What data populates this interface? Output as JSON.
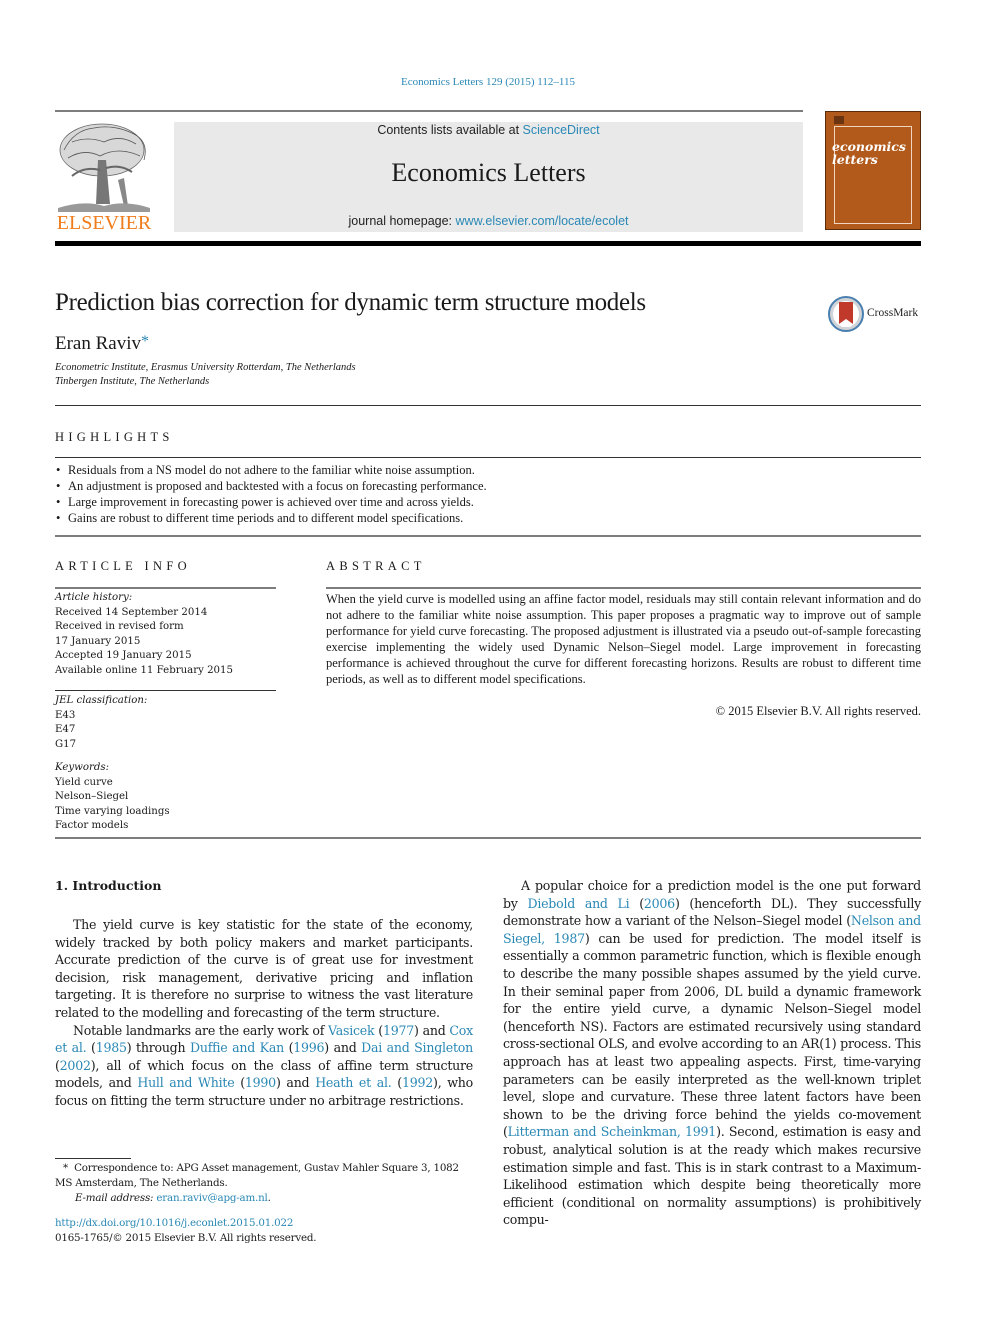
{
  "running_head": "Economics Letters 129 (2015) 112–115",
  "publisher": {
    "logo_word": "ELSEVIER",
    "colors": {
      "orange": "#f07c1b",
      "link_blue": "#2a88b5",
      "cover_brown": "#b15a1b",
      "banner_gray": "#e9e9e9"
    }
  },
  "banner": {
    "contents_prefix": "Contents lists available at ",
    "contents_link": "ScienceDirect",
    "journal_title": "Economics Letters",
    "homepage_prefix": "journal homepage: ",
    "homepage_link": "www.elsevier.com/locate/ecolet"
  },
  "cover": {
    "title_line1": "economics",
    "title_line2": "letters"
  },
  "article": {
    "title": "Prediction bias correction for dynamic term structure models",
    "author": "Eran Raviv",
    "author_mark": "*",
    "affiliations": [
      "Econometric Institute, Erasmus University Rotterdam, The Netherlands",
      "Tinbergen Institute, The Netherlands"
    ],
    "crossmark_label": "CrossMark"
  },
  "highlights": {
    "heading": "HIGHLIGHTS",
    "items": [
      "Residuals from a NS model do not adhere to the familiar white noise assumption.",
      "An adjustment is proposed and backtested with a focus on forecasting performance.",
      "Large improvement in forecasting power is achieved over time and across yields.",
      "Gains are robust to different time periods and to different model specifications."
    ]
  },
  "article_info": {
    "heading": "ARTICLE INFO",
    "history_label": "Article history:",
    "history": [
      "Received 14 September 2014",
      "Received in revised form",
      "17 January 2015",
      "Accepted 19 January 2015",
      "Available online 11 February 2015"
    ],
    "jel_label": "JEL classification:",
    "jel": [
      "E43",
      "E47",
      "G17"
    ],
    "keywords_label": "Keywords:",
    "keywords": [
      "Yield curve",
      "Nelson–Siegel",
      "Time varying loadings",
      "Factor models"
    ]
  },
  "abstract": {
    "heading": "ABSTRACT",
    "text": "When the yield curve is modelled using an affine factor model, residuals may still contain relevant information and do not adhere to the familiar white noise assumption. This paper proposes a pragmatic way to improve out of sample performance for yield curve forecasting. The proposed adjustment is illustrated via a pseudo out-of-sample forecasting exercise implementing the widely used Dynamic Nelson–Siegel model. Large improvement in forecasting performance is achieved throughout the curve for different forecasting horizons. Results are robust to different time periods, as well as to different model specifications.",
    "copyright": "© 2015 Elsevier B.V. All rights reserved."
  },
  "introduction": {
    "heading": "1.  Introduction",
    "p1": "The yield curve is key statistic for the state of the economy, widely tracked by both policy makers and market participants. Accurate prediction of the curve is of great use for investment decision, risk management, derivative pricing and inflation targeting. It is therefore no surprise to witness the vast literature related to the modelling and forecasting of the term structure.",
    "p2": {
      "t0": "Notable landmarks are the early work of ",
      "l0": "Vasicek",
      "t1": " (",
      "l1": "1977",
      "t2": ") and ",
      "l2": "Cox et al.",
      "t3": " (",
      "l3": "1985",
      "t4": ") through ",
      "l4": "Duffie and Kan",
      "t5": " (",
      "l5": "1996",
      "t6": ") and ",
      "l6": "Dai and Singleton",
      "t7": " (",
      "l7": "2002",
      "t8": "), all of which focus on the class of affine term structure models, and ",
      "l8": "Hull and White",
      "t9": " (",
      "l9": "1990",
      "t10": ") and ",
      "l10": "Heath et al.",
      "t11": " (",
      "l11": "1992",
      "t12": "), who focus on fitting the term structure under no arbitrage restrictions."
    },
    "p3": {
      "t0": "A popular choice for a prediction model is the one put forward by ",
      "l0": "Diebold and Li",
      "t1": " (",
      "l1": "2006",
      "t2": ") (henceforth DL). They successfully demonstrate how a variant of the Nelson–Siegel model (",
      "l2": "Nelson and Siegel, 1987",
      "t3": ") can be used for prediction. The model itself is essentially a common parametric function, which is flexible enough to describe the many possible shapes assumed by the yield curve. In their seminal paper from 2006, DL build a dynamic framework for the entire yield curve, a dynamic Nelson–Siegel model (henceforth NS). Factors are estimated recursively using standard cross-sectional OLS, and evolve according to an AR(1) process. This approach has at least two appealing aspects. First, time-varying parameters can be easily interpreted as the well-known triplet level, slope and curvature. These three latent factors have been shown to be the driving force behind the yields co-movement (",
      "l3": "Litterman and Scheinkman, 1991",
      "t4": "). Second, estimation is easy and robust, analytical solution is at the ready which makes recursive estimation simple and fast. This is in stark contrast to a Maximum-Likelihood estimation which despite being theoretically more efficient (conditional on normality assumptions) is prohibitively compu-"
    }
  },
  "footnote": {
    "mark": "*",
    "correspondence": "Correspondence to: APG Asset management, Gustav Mahler Square 3, 1082 MS Amsterdam, The Netherlands.",
    "email_label": "E-mail address: ",
    "email": "eran.raviv@apg-am.nl",
    "email_suffix": "."
  },
  "doi": {
    "link": "http://dx.doi.org/10.1016/j.econlet.2015.01.022",
    "issn_line": "0165-1765/© 2015 Elsevier B.V. All rights reserved."
  }
}
